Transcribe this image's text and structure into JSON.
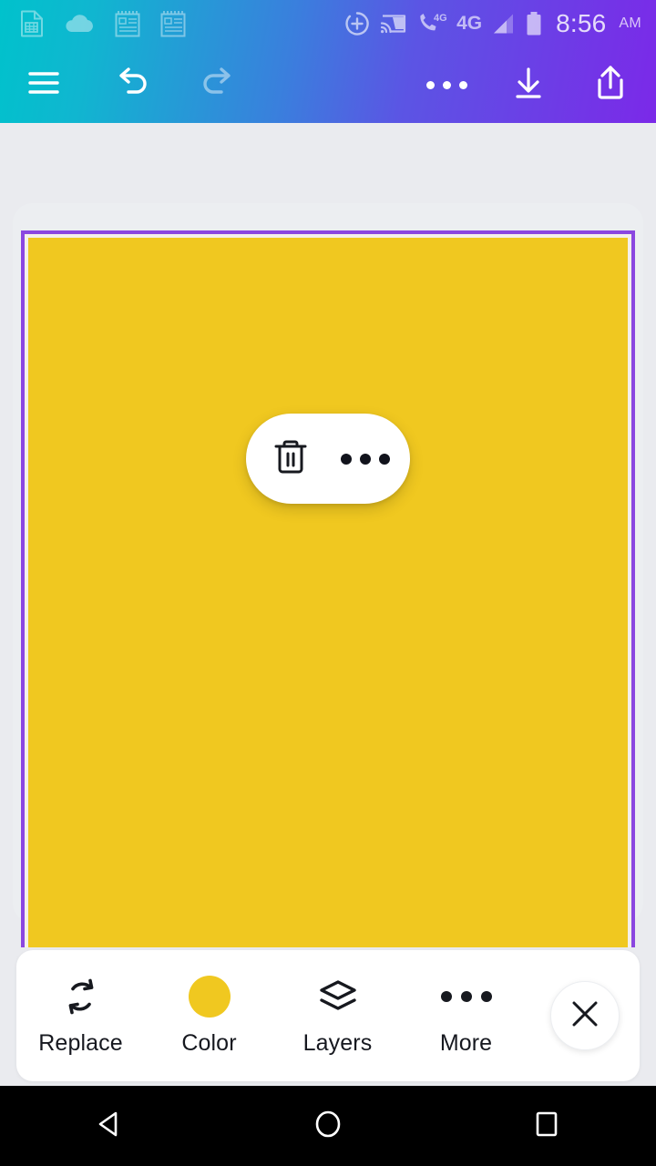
{
  "status_bar": {
    "time": "8:56",
    "ampm": "AM",
    "network_label": "4G",
    "volte_label": "4G",
    "left_icons": [
      {
        "name": "spreadsheet-notification-icon",
        "label": "Spreadsheet"
      },
      {
        "name": "cloud-notification-icon",
        "label": "Cloud"
      },
      {
        "name": "notepad-notification-icon",
        "label": "Note"
      },
      {
        "name": "notepad-notification-icon-2",
        "label": "Note"
      }
    ],
    "right_icons": [
      {
        "name": "sync-add-icon",
        "label": "Sync"
      },
      {
        "name": "cast-icon",
        "label": "Cast"
      },
      {
        "name": "volte-call-icon",
        "label": "VoLTE"
      },
      {
        "name": "signal-bars-icon",
        "label": "Signal"
      },
      {
        "name": "battery-icon",
        "label": "Battery"
      }
    ]
  },
  "toolbar": {
    "menu_label": "Menu",
    "undo_label": "Undo",
    "redo_label": "Redo",
    "more_label": "More options",
    "download_label": "Download",
    "share_label": "Share"
  },
  "canvas": {
    "element_fill_color": "#f0c820",
    "selection_border_color": "#8b47e0",
    "background_color": "#eaebef",
    "element_popup": {
      "delete_label": "Delete",
      "more_label": "More"
    }
  },
  "bottom_bar": {
    "items": [
      {
        "label": "Replace",
        "icon": "replace-icon"
      },
      {
        "label": "Color",
        "icon": "color-swatch-icon"
      },
      {
        "label": "Layers",
        "icon": "layers-icon"
      },
      {
        "label": "More",
        "icon": "more-dots-icon"
      }
    ],
    "close_label": "Close"
  },
  "nav_bar": {
    "back_label": "Back",
    "home_label": "Home",
    "recents_label": "Recents"
  },
  "theme": {
    "gradient_start": "#00c2cc",
    "gradient_mid": "#4a6fe0",
    "gradient_end": "#7b29e8",
    "accent_yellow": "#f0c820",
    "accent_purple": "#8b47e0"
  }
}
